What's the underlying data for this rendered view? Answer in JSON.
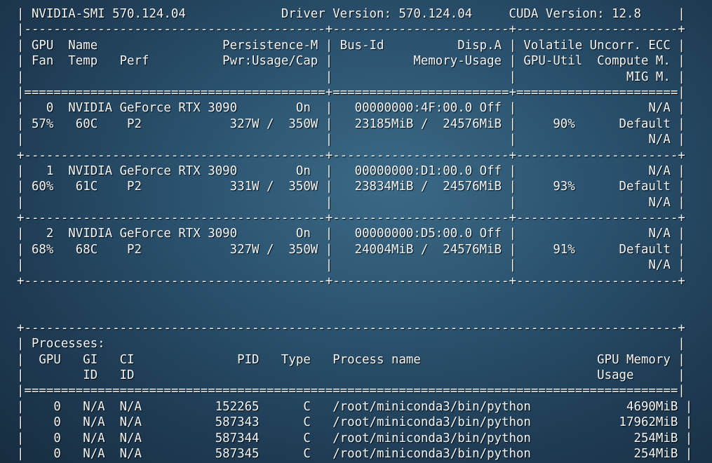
{
  "terminal": {
    "lines": [
      "| NVIDIA-SMI 570.124.04             Driver Version: 570.124.04     CUDA Version: 12.8     |",
      "|-----------------------------------------+------------------------+----------------------+",
      "| GPU  Name                 Persistence-M | Bus-Id          Disp.A | Volatile Uncorr. ECC |",
      "| Fan  Temp   Perf          Pwr:Usage/Cap |           Memory-Usage | GPU-Util  Compute M. |",
      "|                                         |                        |               MIG M. |",
      "|=========================================+========================+======================|",
      "|   0  NVIDIA GeForce RTX 3090        On  |   00000000:4F:00.0 Off |                  N/A |",
      "| 57%   60C    P2            327W /  350W |   23185MiB /  24576MiB |     90%      Default |",
      "|                                         |                        |                  N/A |",
      "+-----------------------------------------+------------------------+----------------------+",
      "|   1  NVIDIA GeForce RTX 3090        On  |   00000000:D1:00.0 Off |                  N/A |",
      "| 60%   61C    P2            331W /  350W |   23834MiB /  24576MiB |     93%      Default |",
      "|                                         |                        |                  N/A |",
      "+-----------------------------------------+------------------------+----------------------+",
      "|   2  NVIDIA GeForce RTX 3090        On  |   00000000:D5:00.0 Off |                  N/A |",
      "| 68%   68C    P2            327W /  350W |   24004MiB /  24576MiB |     91%      Default |",
      "|                                         |                        |                  N/A |",
      "+-----------------------------------------+------------------------+----------------------+",
      "",
      "",
      "+-----------------------------------------------------------------------------------------+",
      "| Processes:                                                                              |",
      "|  GPU   GI   CI              PID   Type   Process name                        GPU Memory |",
      "|        ID   ID                                                               Usage      |",
      "|=========================================================================================|",
      "|    0   N/A  N/A          152265      C   /root/miniconda3/bin/python             4690MiB |",
      "|    0   N/A  N/A          587343      C   /root/miniconda3/bin/python            17962MiB |",
      "|    0   N/A  N/A          587344      C   /root/miniconda3/bin/python              254MiB |",
      "|    0   N/A  N/A          587345      C   /root/miniconda3/bin/python              254MiB |"
    ]
  }
}
